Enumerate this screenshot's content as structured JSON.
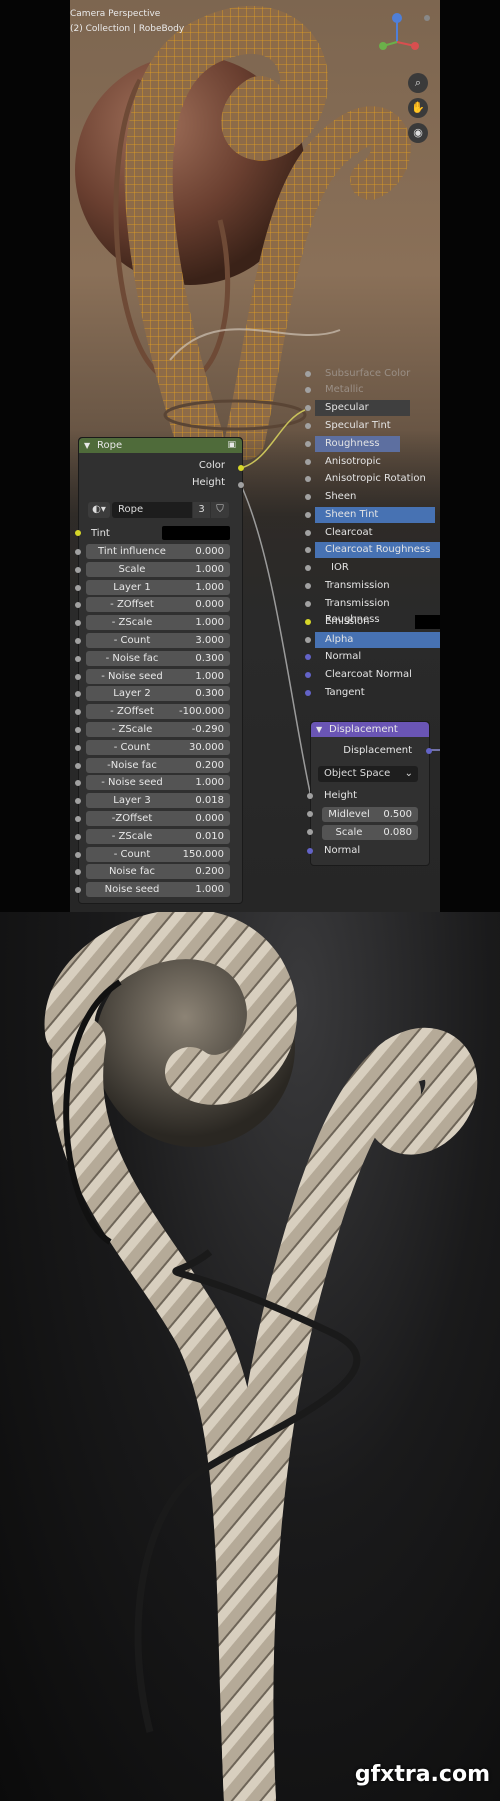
{
  "viewport": {
    "title": "Camera Perspective",
    "collection": "(2) Collection | RobeBody"
  },
  "rope_node": {
    "title": "Rope",
    "outputs": [
      "Color",
      "Height"
    ],
    "group_name": "Rope",
    "users": "3",
    "tint_label": "Tint",
    "fields": [
      {
        "label": "Tint influence",
        "value": "0.000"
      },
      {
        "label": "Scale",
        "value": "1.000"
      },
      {
        "label": "Layer 1",
        "value": "1.000"
      },
      {
        "label": "- ZOffset",
        "value": "0.000"
      },
      {
        "label": "- ZScale",
        "value": "1.000"
      },
      {
        "label": "- Count",
        "value": "3.000"
      },
      {
        "label": "- Noise fac",
        "value": "0.300"
      },
      {
        "label": "- Noise seed",
        "value": "1.000"
      },
      {
        "label": "Layer 2",
        "value": "0.300"
      },
      {
        "label": "- ZOffset",
        "value": "-100.000"
      },
      {
        "label": "- ZScale",
        "value": "-0.290"
      },
      {
        "label": "- Count",
        "value": "30.000"
      },
      {
        "label": "-Noise fac",
        "value": "0.200"
      },
      {
        "label": "- Noise seed",
        "value": "1.000"
      },
      {
        "label": "Layer 3",
        "value": "0.018"
      },
      {
        "label": "-ZOffset",
        "value": "0.000"
      },
      {
        "label": "- ZScale",
        "value": "0.010"
      },
      {
        "label": "- Count",
        "value": "150.000"
      },
      {
        "label": "Noise fac",
        "value": "0.200"
      },
      {
        "label": "Noise seed",
        "value": "1.000"
      }
    ]
  },
  "bsdf": {
    "rows": [
      {
        "label": "Subsurface Color",
        "style": "dim"
      },
      {
        "label": "Metallic",
        "style": "dim"
      },
      {
        "label": "Specular",
        "style": "bar"
      },
      {
        "label": "Specular Tint",
        "style": "plain"
      },
      {
        "label": "Roughness",
        "style": "bar"
      },
      {
        "label": "Anisotropic",
        "style": "plain"
      },
      {
        "label": "Anisotropic Rotation",
        "style": "plain"
      },
      {
        "label": "Sheen",
        "style": "plain"
      },
      {
        "label": "Sheen Tint",
        "style": "hl"
      },
      {
        "label": "Clearcoat",
        "style": "plain"
      },
      {
        "label": "Clearcoat Roughness",
        "style": "hl"
      },
      {
        "label": "IOR",
        "style": "plain"
      },
      {
        "label": "Transmission",
        "style": "plain"
      },
      {
        "label": "Transmission Roughness",
        "style": "plain"
      },
      {
        "label": "Emission",
        "style": "plain"
      },
      {
        "label": "Alpha",
        "style": "hl"
      },
      {
        "label": "Normal",
        "style": "plain"
      },
      {
        "label": "Clearcoat Normal",
        "style": "plain"
      },
      {
        "label": "Tangent",
        "style": "plain"
      }
    ]
  },
  "displacement_node": {
    "title": "Displacement",
    "output": "Displacement",
    "space": "Object Space",
    "height_label": "Height",
    "midlevel_label": "Midlevel",
    "midlevel_value": "0.500",
    "scale_label": "Scale",
    "scale_value": "0.080",
    "normal_label": "Normal"
  },
  "watermark": "gfxtra.com",
  "colors": {
    "rope_header": "#4f6b3a",
    "displacement_header": "#6a55b5",
    "highlight": "#4772b3",
    "socket_yellow": "#d6d629",
    "socket_blue": "#6363c7",
    "wireframe": "#e8a21e"
  }
}
